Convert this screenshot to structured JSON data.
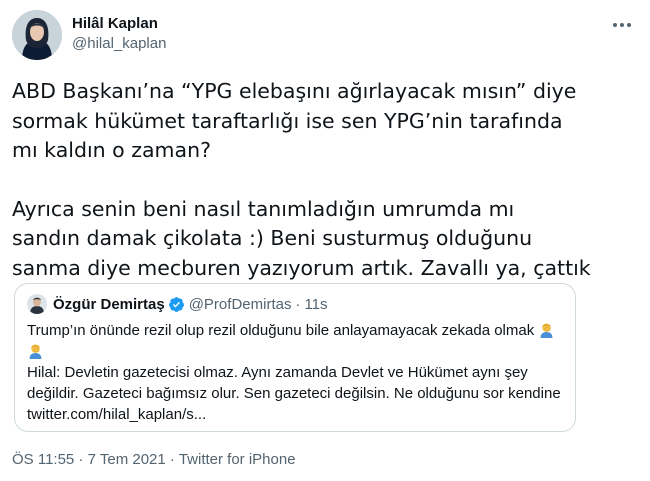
{
  "author": {
    "display_name": "Hilâl Kaplan",
    "handle": "@hilal_kaplan",
    "avatar_icon": "profile-photo",
    "more_icon": "more-dots-icon"
  },
  "tweet": {
    "lines": [
      "ABD Başkanı’na “YPG elebaşını ağırlayacak mısın” diye",
      "sormak hükümet taraftarlığı ise sen YPG’nin tarafında",
      "mı kaldın o zaman?",
      "Ayrıca senin beni nasıl tanımladığın umrumda mı",
      "sandın damak çikolata :) Beni susturmuş olduğunu",
      "sanma diye mecburen yazıyorum artık. Zavallı ya, çattık"
    ]
  },
  "quoted_tweet": {
    "display_name": "Özgür Demirtaş",
    "verified_icon": "verified-badge-icon",
    "handle": "@ProfDemirtas",
    "separator": "·",
    "time": "11s",
    "line1": "Trump’ın önünde rezil olup rezil olduğunu bile anlayamayacak zekada olmak",
    "emoji_icon": "person-facepalming-emoji",
    "body": "Hilal: Devletin gazetecisi olmaz. Aynı zamanda Devlet ve Hükümet aynı şey değildir. Gazeteci bağımsız olur. Sen gazeteci değilsin. Ne olduğunu sor kendine twitter.com/hilal_kaplan/s..."
  },
  "meta": {
    "time": "ÖS 11:55",
    "sep1": "·",
    "date": "7 Tem 2021",
    "sep2": "·",
    "source": "Twitter for iPhone"
  },
  "colors": {
    "text": "#0f1419",
    "secondary": "#536471",
    "border": "#cfd9de",
    "verified": "#1d9bf0"
  }
}
